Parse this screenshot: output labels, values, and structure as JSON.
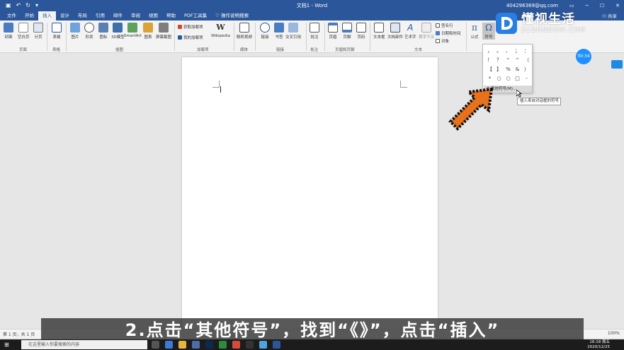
{
  "window": {
    "title": "文档1 - Word",
    "account": "404296369@qq.com"
  },
  "tabs": [
    {
      "label": "文件"
    },
    {
      "label": "开始"
    },
    {
      "label": "插入"
    },
    {
      "label": "设计"
    },
    {
      "label": "布局"
    },
    {
      "label": "引用"
    },
    {
      "label": "邮件"
    },
    {
      "label": "审阅"
    },
    {
      "label": "视图"
    },
    {
      "label": "帮助"
    },
    {
      "label": "PDF工具集"
    },
    {
      "label": "操作说明搜索"
    }
  ],
  "share_label": "共享",
  "ribbon": {
    "pages": {
      "group": "页面",
      "items": [
        "封面",
        "空白页",
        "分页"
      ]
    },
    "tables": {
      "group": "表格",
      "items": [
        "表格"
      ]
    },
    "illustrations": {
      "group": "插图",
      "items": [
        "图片",
        "形状",
        "图标",
        "3D模型",
        "SmartArt",
        "图表",
        "屏幕截图"
      ]
    },
    "addins": {
      "group": "加载项",
      "items": [
        "获取加载项",
        "我的加载项",
        "Wikipedia"
      ]
    },
    "media": {
      "group": "媒体",
      "items": [
        "联机视频"
      ]
    },
    "links": {
      "group": "链接",
      "items": [
        "链接",
        "书签",
        "交叉引用"
      ]
    },
    "comments": {
      "group": "批注",
      "items": [
        "批注"
      ]
    },
    "headerfooter": {
      "group": "页眉和页脚",
      "items": [
        "页眉",
        "页脚",
        "页码"
      ]
    },
    "text": {
      "group": "文本",
      "items": [
        "文本框",
        "文档部件",
        "艺术字",
        "首字下沉",
        "签名行",
        "日期和时间",
        "对象"
      ]
    },
    "symbols": {
      "items": [
        "公式",
        "符号"
      ]
    }
  },
  "symbols_dropdown": {
    "symbols": [
      "，",
      "。",
      "、",
      "；",
      "：",
      "！",
      "？",
      "“",
      "”",
      "（",
      "【",
      "】",
      "%",
      "&",
      "）",
      "*",
      "○",
      "○",
      "□",
      "-"
    ],
    "more_label": "其他符号(M)...",
    "tooltip": "插入来自对话框的符号"
  },
  "timer": "00:34",
  "logo": {
    "name": "懂视生活",
    "sub": "51DONGSHI.COM"
  },
  "status": {
    "page": "第 1 页，共 1 页",
    "zoom": "100%"
  },
  "caption": "2.点击“其他符号”，找到“《》”，点击“插入”",
  "taskbar": {
    "search_placeholder": "在这里输入你要搜索的内容",
    "time": "16:18 周五",
    "date": "2020/12/25"
  }
}
